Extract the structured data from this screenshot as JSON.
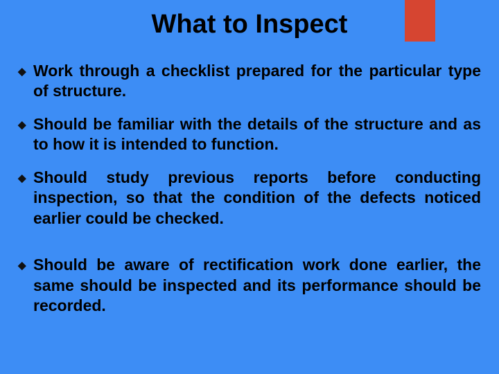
{
  "accent_color": "#d64531",
  "background_color": "#3d8df5",
  "title": "What to Inspect",
  "bullets": [
    {
      "text": "Work through a checklist prepared for the particular type of structure.",
      "gap": false
    },
    {
      "text": "Should be familiar with the details of the structure and as to how it is intended to function.",
      "gap": false
    },
    {
      "text": "Should study previous reports before conducting inspection, so that the condition of the defects noticed earlier could be checked.",
      "gap": true
    },
    {
      "text": "Should be aware of rectification work done earlier, the same should be inspected and its performance should be recorded.",
      "gap": false
    }
  ],
  "bullet_glyph": "◆"
}
